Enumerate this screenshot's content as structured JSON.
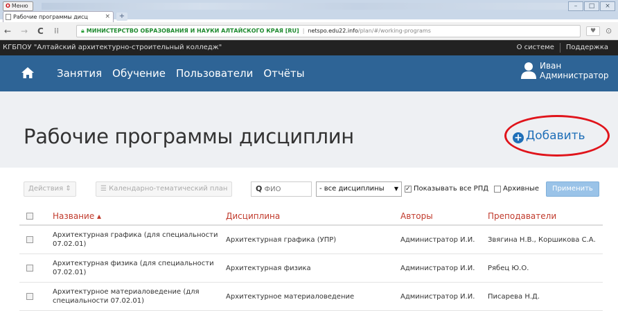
{
  "browser": {
    "menu_label": "Меню",
    "tab_title": "Рабочие программы дисц",
    "tab_close": "×",
    "new_tab": "+",
    "back": "←",
    "forward": "→",
    "reload": "C",
    "apps": "⁞⁞",
    "cert_label": "МИНИСТЕРСТВО ОБРАЗОВАНИЯ И НАУКИ АЛТАЙСКОГО КРАЯ [RU]",
    "url_host": "netspo.edu22.info",
    "url_path": "/plan/#/working-programs"
  },
  "site": {
    "org_name": "КГБПОУ \"Алтайский архитектурно-строительный колледж\"",
    "about": "О системе",
    "support": "Поддержка"
  },
  "nav": {
    "items": [
      "Занятия",
      "Обучение",
      "Пользователи",
      "Отчёты"
    ],
    "user_first": "Иван",
    "user_role": "Администратор"
  },
  "page": {
    "title": "Рабочие программы дисциплин",
    "add_label": "Добавить"
  },
  "toolbar": {
    "actions": "Действия ⇕",
    "calendar_plan": "Календарно-тематический план",
    "search_placeholder": "ФИО",
    "discipline_filter": "- все дисциплины",
    "show_all": "Показывать все РПД",
    "archived": "Архивные",
    "apply": "Применить"
  },
  "table": {
    "headers": {
      "name": "Название ▴",
      "discipline": "Дисциплина",
      "authors": "Авторы",
      "teachers": "Преподаватели"
    },
    "rows": [
      {
        "name": "Архитектурная графика (для специальности 07.02.01)",
        "discipline": "Архитектурная графика (УПР)",
        "authors": "Администратор И.И.",
        "teachers": "Звягина Н.В., Коршикова С.А."
      },
      {
        "name": "Архитектурная физика (для специальности 07.02.01)",
        "discipline": "Архитектурная физика",
        "authors": "Администратор И.И.",
        "teachers": "Рябец Ю.О."
      },
      {
        "name": "Архитектурное материаловедение (для специальности 07.02.01)",
        "discipline": "Архитектурное материаловедение",
        "authors": "Администратор И.И.",
        "teachers": "Писарева Н.Д."
      }
    ]
  },
  "colors": {
    "nav_bg": "#2e6496",
    "header_text": "#c0392b",
    "accent": "#1f6fb8",
    "highlight_oval": "#e0141b"
  }
}
